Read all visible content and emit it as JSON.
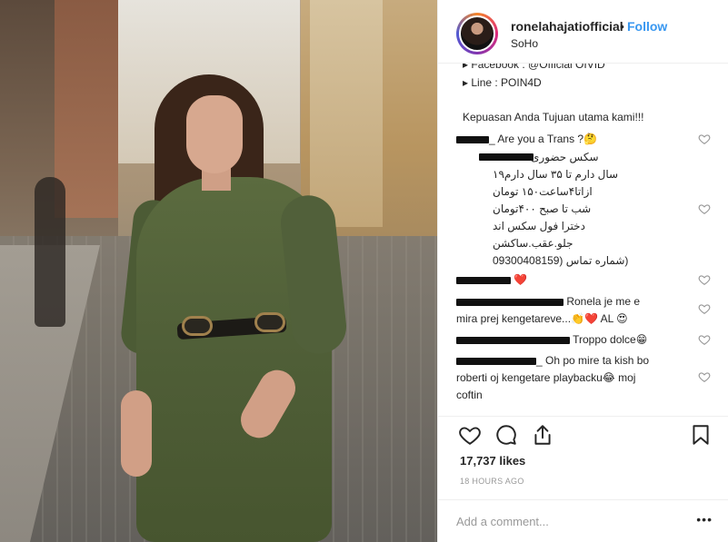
{
  "post": {
    "username": "ronelahajatiofficial",
    "separator": "•",
    "follow_label": "Follow",
    "location": "SoHo"
  },
  "caption": {
    "clipped_line": "▸ Facebook : @Official OIVID",
    "line_label": "▸ Line : POIN4D",
    "message": "Kepuasan Anda Tujuan utama kami!!!"
  },
  "comments": [
    {
      "text": "Are you a Trans ?",
      "emoji": "🤔"
    },
    {
      "lines": [
        "سکس حضوری ۲۶۱۳۱۱",
        "سال دارم تا ۳۵ سال دارم۱۹",
        "ازاتا۴ساعت۱۵۰ تومان",
        "شب تا صبح ۴۰۰تومان",
        "دخترا فول سکس اند",
        "جلو.عقب.ساکشن",
        "(شماره تماس (09300408159"
      ]
    },
    {
      "text": "",
      "emoji": "❤️"
    },
    {
      "line1": "Ronela je me e",
      "line2": "mira prej kengetareve...",
      "emoji": "👏❤️ AL 😍"
    },
    {
      "text": "Troppo dolce",
      "emoji": "😁"
    },
    {
      "line1": "_ Oh po mire ta kish bo",
      "line2": "roberti oj kengetare playbacku",
      "emoji": "😂",
      "line3": " moj",
      "line4": "coftin"
    }
  ],
  "footer": {
    "likes": "17,737 likes",
    "time": "18 HOURS AGO",
    "add_comment_placeholder": "Add a comment...",
    "more_label": "•••"
  },
  "colors": {
    "follow_blue": "#3897f0",
    "text": "#262626",
    "muted": "#999999",
    "border": "#efefef"
  },
  "icons": [
    "heart-icon",
    "comment-icon",
    "share-icon",
    "bookmark-icon"
  ]
}
